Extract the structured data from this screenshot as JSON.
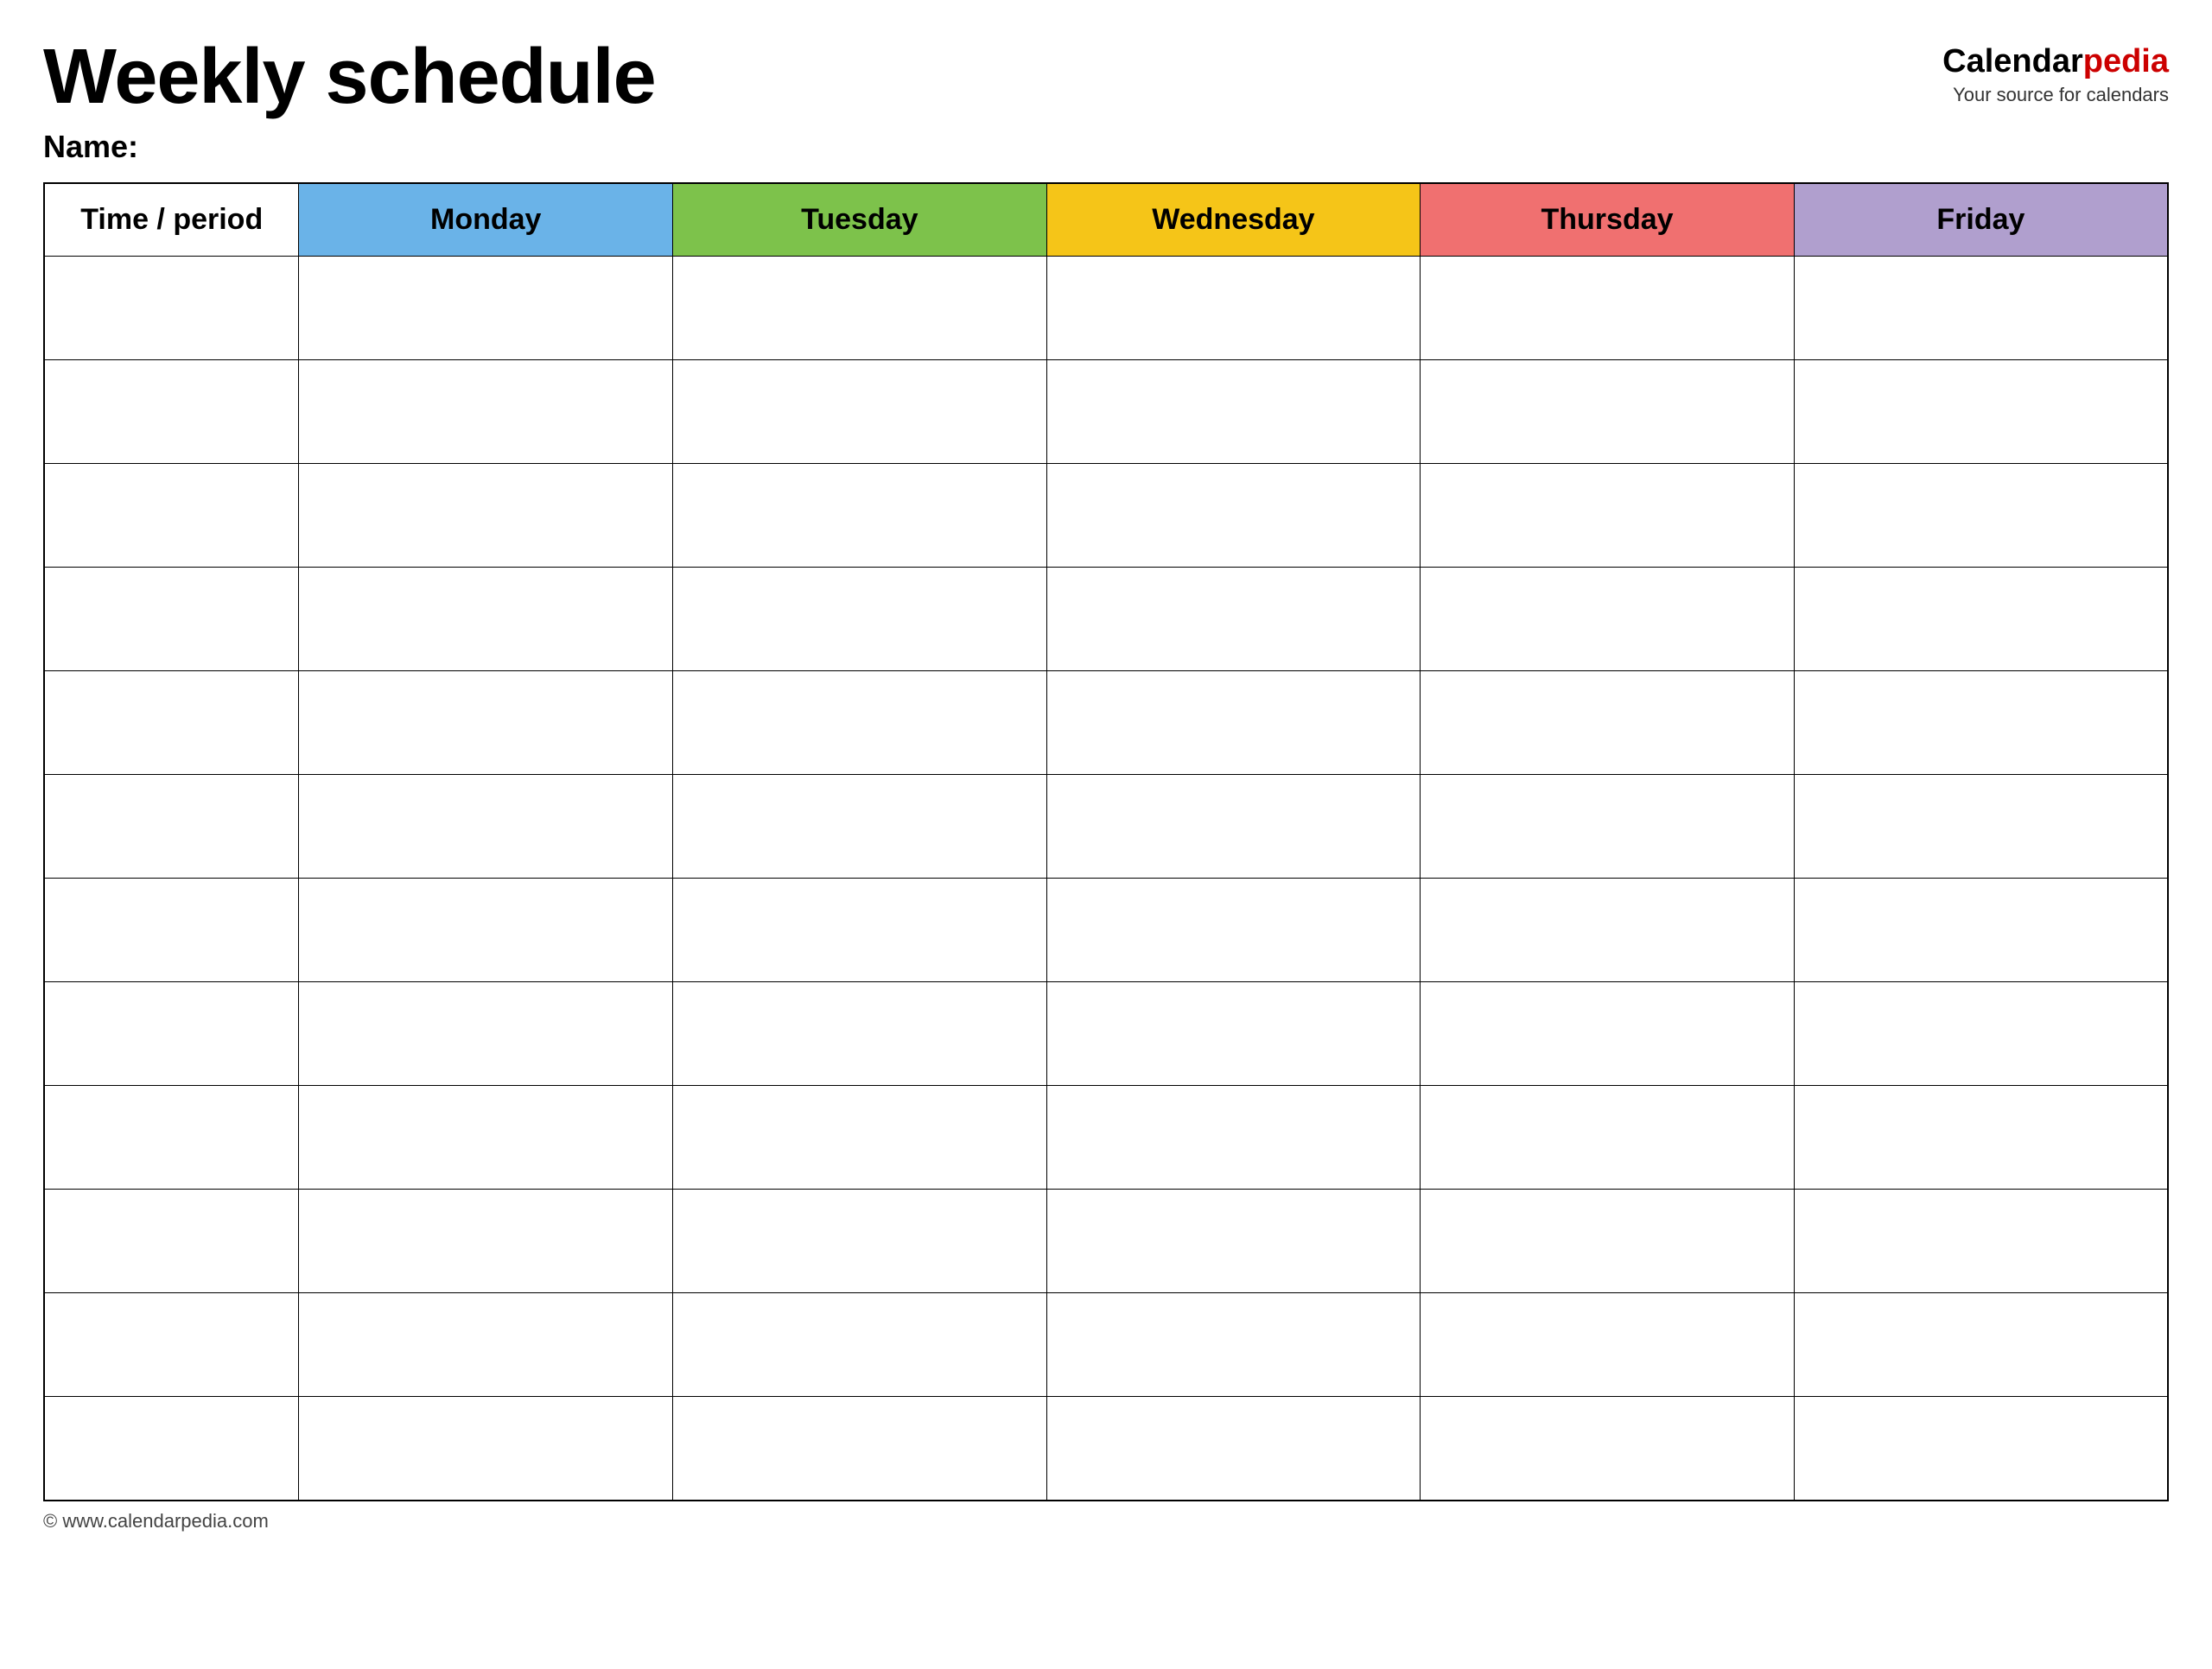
{
  "header": {
    "title": "Weekly schedule",
    "logo_brand": "Calendar",
    "logo_brand_accent": "pedia",
    "logo_tagline": "Your source for calendars",
    "logo_url_display": "www.calendarpedia.com"
  },
  "name_label": "Name:",
  "columns": [
    {
      "key": "time",
      "label": "Time / period",
      "color": "#ffffff"
    },
    {
      "key": "monday",
      "label": "Monday",
      "color": "#6ab3e8"
    },
    {
      "key": "tuesday",
      "label": "Tuesday",
      "color": "#7dc24b"
    },
    {
      "key": "wednesday",
      "label": "Wednesday",
      "color": "#f5c518"
    },
    {
      "key": "thursday",
      "label": "Thursday",
      "color": "#f07070"
    },
    {
      "key": "friday",
      "label": "Friday",
      "color": "#b09fce"
    }
  ],
  "rows": 12,
  "footer": {
    "url": "© www.calendarpedia.com"
  }
}
